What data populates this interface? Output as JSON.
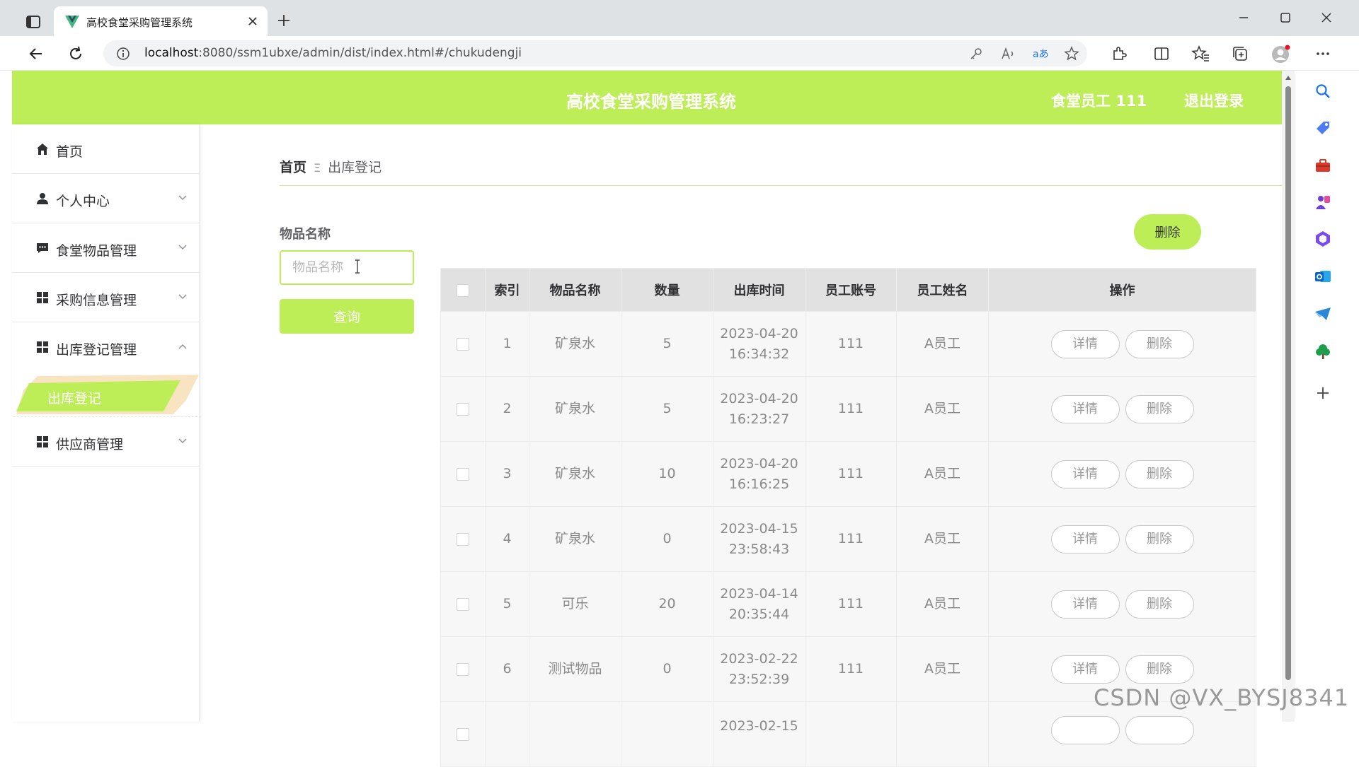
{
  "browser": {
    "tab_title": "高校食堂采购管理系统",
    "url_host": "localhost",
    "url_rest": ":8080/ssm1ubxe/admin/dist/index.html#/chukudengji"
  },
  "header": {
    "title": "高校食堂采购管理系统",
    "user": "食堂员工 111",
    "logout": "退出登录"
  },
  "sidebar": {
    "items": [
      {
        "label": "首页",
        "icon": "home-icon"
      },
      {
        "label": "个人中心",
        "icon": "user-icon"
      },
      {
        "label": "食堂物品管理",
        "icon": "chat-icon"
      },
      {
        "label": "采购信息管理",
        "icon": "grid-icon"
      },
      {
        "label": "出库登记管理",
        "icon": "grid-icon"
      },
      {
        "label": "供应商管理",
        "icon": "grid-icon"
      }
    ],
    "active_sub": "出库登记"
  },
  "breadcrumb": {
    "home": "首页",
    "separator": "Ξ",
    "current": "出库登记"
  },
  "search": {
    "label": "物品名称",
    "placeholder": "物品名称",
    "button": "查询"
  },
  "actions": {
    "delete": "删除"
  },
  "table": {
    "headers": [
      "索引",
      "物品名称",
      "数量",
      "出库时间",
      "员工账号",
      "员工姓名",
      "操作"
    ],
    "rows": [
      {
        "index": "1",
        "name": "矿泉水",
        "qty": "5",
        "date": "2023-04-20",
        "time": "16:34:32",
        "account": "111",
        "staff": "A员工"
      },
      {
        "index": "2",
        "name": "矿泉水",
        "qty": "5",
        "date": "2023-04-20",
        "time": "16:23:27",
        "account": "111",
        "staff": "A员工"
      },
      {
        "index": "3",
        "name": "矿泉水",
        "qty": "10",
        "date": "2023-04-20",
        "time": "16:16:25",
        "account": "111",
        "staff": "A员工"
      },
      {
        "index": "4",
        "name": "矿泉水",
        "qty": "0",
        "date": "2023-04-15",
        "time": "23:58:43",
        "account": "111",
        "staff": "A员工"
      },
      {
        "index": "5",
        "name": "可乐",
        "qty": "20",
        "date": "2023-04-14",
        "time": "20:35:44",
        "account": "111",
        "staff": "A员工"
      },
      {
        "index": "6",
        "name": "测试物品",
        "qty": "0",
        "date": "2023-02-22",
        "time": "23:52:39",
        "account": "111",
        "staff": "A员工"
      },
      {
        "index": "",
        "name": "",
        "qty": "",
        "date": "2023-02-15",
        "time": "",
        "account": "",
        "staff": ""
      }
    ],
    "detail_label": "详情",
    "delete_label": "删除"
  },
  "watermark": "CSDN @VX_BYSJ8341",
  "colors": {
    "accent": "#bdee57",
    "header_bg": "#bdee57",
    "table_header_bg": "#e1e1e1"
  }
}
